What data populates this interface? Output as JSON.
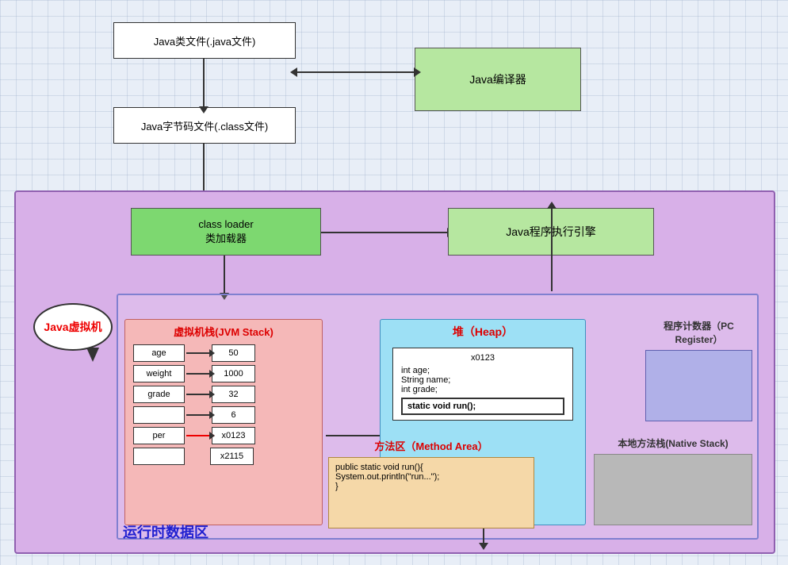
{
  "top": {
    "java_class_file": "Java类文件(.java文件)",
    "java_compiler": "Java编译器",
    "java_bytecode_file": "Java字节码文件(.class文件)"
  },
  "jvm": {
    "bubble_label": "Java虚拟机",
    "class_loader_line1": "class loader",
    "class_loader_line2": "类加载器",
    "exec_engine": "Java程序执行引擎",
    "runtime_label": "运行时数据区",
    "jvm_stack": {
      "title": "虚拟机栈(JVM Stack)",
      "rows": [
        {
          "name": "age",
          "value": "50"
        },
        {
          "name": "weight",
          "value": "1000"
        },
        {
          "name": "grade",
          "value": "32"
        },
        {
          "name": "",
          "value": "6"
        },
        {
          "name": "per",
          "value": "x0123"
        },
        {
          "name": "",
          "value": "x2115"
        }
      ]
    },
    "heap": {
      "title": "堆（Heap）",
      "object_id": "x0123",
      "fields": [
        "int age;",
        "String name;",
        "int grade;"
      ],
      "method_box": "static void run();"
    },
    "pc_register": {
      "title": "程序计数器（PC Register）"
    },
    "method_area": {
      "title": "方法区（Method Area）",
      "code_line1": "public static void run(){",
      "code_line2": "System.out.println(\"run...\");",
      "code_line3": "}"
    },
    "native_stack": {
      "title": "本地方法栈(Native Stack)"
    }
  }
}
